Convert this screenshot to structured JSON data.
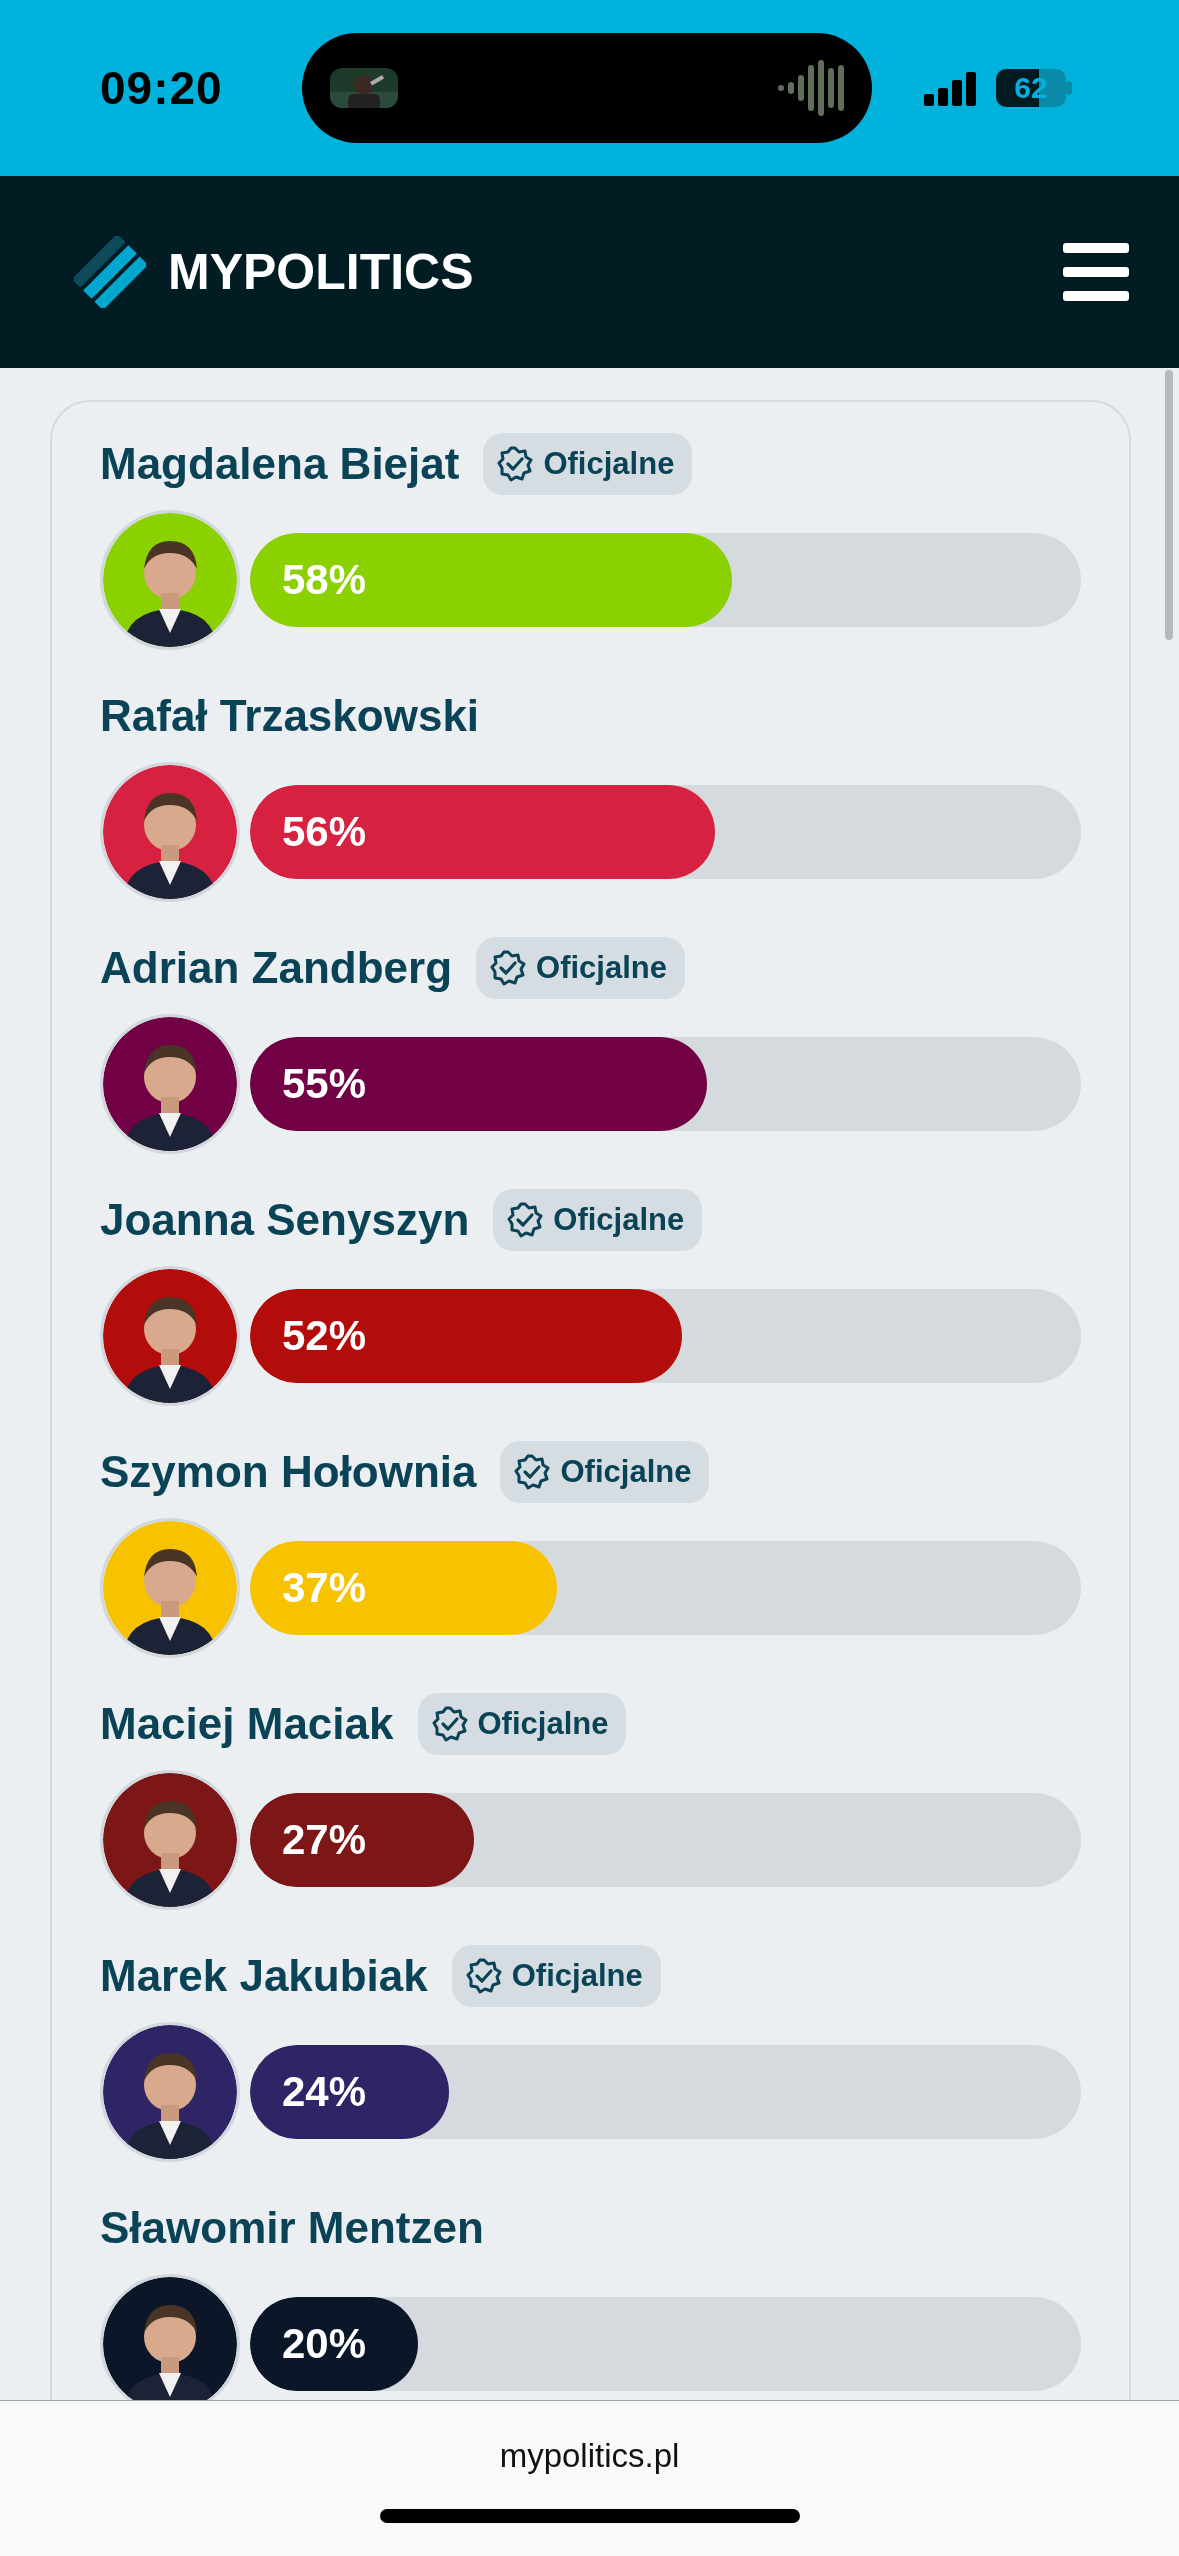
{
  "status_bar": {
    "time": "09:20",
    "battery": "62"
  },
  "header": {
    "logo": "MYPOLITICS"
  },
  "candidates": [
    {
      "name": "Magdalena Biejat",
      "badge": "Oficjalne",
      "percent": "58%",
      "level": 0.58,
      "color": "#8bd000"
    },
    {
      "name": "Rafał Trzaskowski",
      "percent": "56%",
      "level": 0.56,
      "color": "#d62240"
    },
    {
      "name": "Adrian Zandberg",
      "badge": "Oficjalne",
      "percent": "55%",
      "level": 0.55,
      "color": "#710045"
    },
    {
      "name": "Joanna Senyszyn",
      "badge": "Oficjalne",
      "percent": "52%",
      "level": 0.52,
      "color": "#b30d0b"
    },
    {
      "name": "Szymon Hołownia",
      "badge": "Oficjalne",
      "percent": "37%",
      "level": 0.37,
      "color": "#f7c300"
    },
    {
      "name": "Maciej Maciak",
      "badge": "Oficjalne",
      "percent": "27%",
      "level": 0.27,
      "color": "#7d1717"
    },
    {
      "name": "Marek Jakubiak",
      "badge": "Oficjalne",
      "percent": "24%",
      "level": 0.24,
      "color": "#2e2466"
    },
    {
      "name": "Sławomir Mentzen",
      "percent": "20%",
      "level": 0.2,
      "color": "#0c1629"
    }
  ],
  "browser": {
    "url": "mypolitics.pl"
  }
}
